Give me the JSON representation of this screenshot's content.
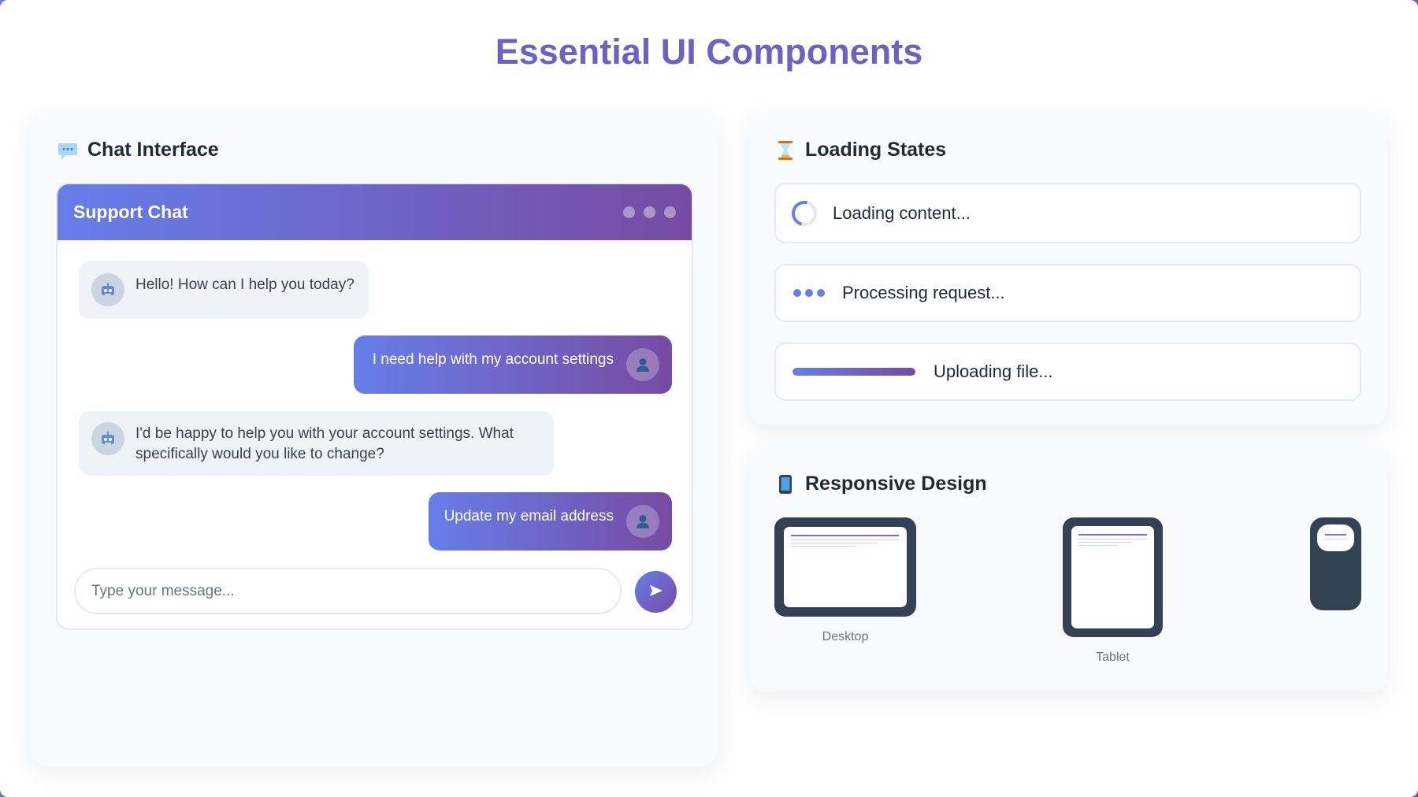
{
  "page": {
    "title": "Essential UI Components"
  },
  "colors": {
    "accent_start": "#667eea",
    "accent_end": "#764ba2",
    "title": "#6b63c4",
    "device": "#334155"
  },
  "chat_card": {
    "heading": "Chat Interface",
    "heading_icon": "speech-bubble-icon",
    "window": {
      "title": "Support Chat",
      "messages": [
        {
          "sender": "bot",
          "avatar_icon": "robot-icon",
          "text": "Hello! How can I help you today?"
        },
        {
          "sender": "user",
          "avatar_icon": "user-icon",
          "text": "I need help with my account settings"
        },
        {
          "sender": "bot",
          "avatar_icon": "robot-icon",
          "text": "I'd be happy to help you with your account settings. What specifically would you like to change?"
        },
        {
          "sender": "user",
          "avatar_icon": "user-icon",
          "text": "Update my email address"
        }
      ],
      "input_placeholder": "Type your message...",
      "send_icon": "send-arrow-icon"
    }
  },
  "loading_card": {
    "heading": "Loading States",
    "heading_icon": "hourglass-icon",
    "states": [
      {
        "type": "spinner",
        "label": "Loading content..."
      },
      {
        "type": "dots",
        "label": "Processing request..."
      },
      {
        "type": "progress",
        "label": "Uploading file...",
        "progress": 1.0
      }
    ]
  },
  "responsive_card": {
    "heading": "Responsive Design",
    "heading_icon": "mobile-phone-icon",
    "devices": [
      {
        "name": "desktop",
        "label": "Desktop"
      },
      {
        "name": "tablet",
        "label": "Tablet"
      },
      {
        "name": "mobile",
        "label": ""
      }
    ]
  }
}
